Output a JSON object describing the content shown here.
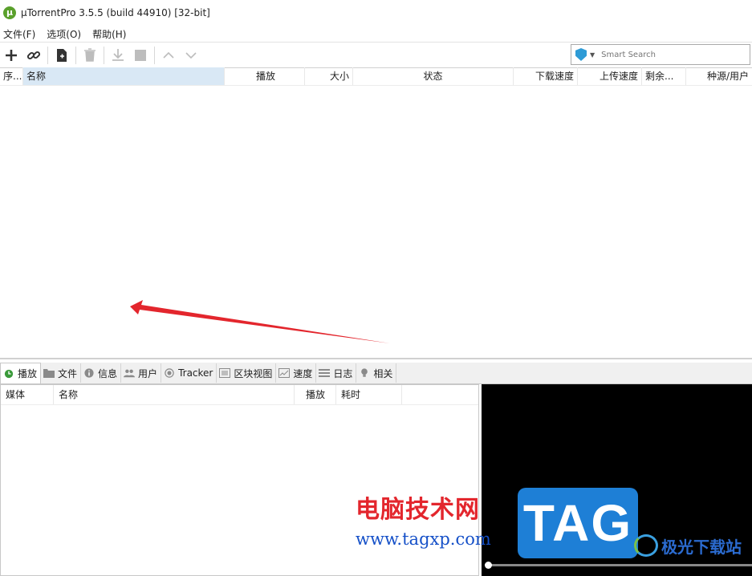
{
  "window": {
    "title": "µTorrentPro 3.5.5  (build 44910) [32-bit]",
    "logo_letter": "μ"
  },
  "menu": [
    "文件(F)",
    "选项(O)",
    "帮助(H)"
  ],
  "toolbar": {
    "search_placeholder": "Smart Search"
  },
  "torrent_table": {
    "columns": [
      "序...",
      "名称",
      "播放",
      "大小",
      "状态",
      "下载速度",
      "上传速度",
      "剩余...",
      "种源/用户"
    ]
  },
  "tabs": [
    "播放",
    "文件",
    "信息",
    "用户",
    "Tracker",
    "区块视图",
    "速度",
    "日志",
    "相关"
  ],
  "media_table": {
    "columns": [
      "媒体",
      "名称",
      "播放",
      "耗时"
    ]
  },
  "player": {
    "progress": 0.0
  },
  "watermark": {
    "cn": "电脑技术网",
    "url": "www.tagxp.com",
    "tag": "TAG",
    "xz": "极光下载站"
  },
  "colors": {
    "accent_selected": "#d9e8f5",
    "arrow": "#e3262d",
    "video_bg": "#000000"
  }
}
